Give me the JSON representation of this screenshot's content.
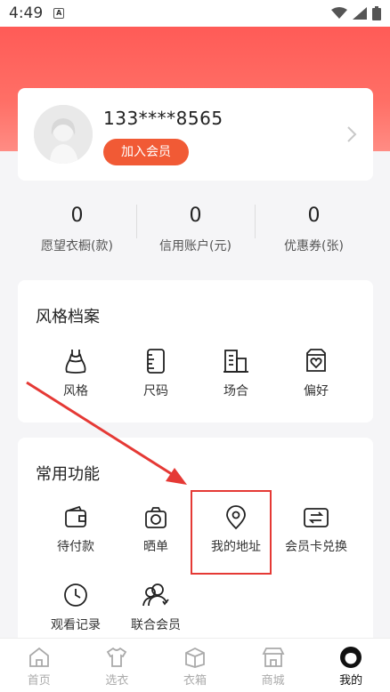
{
  "status_bar": {
    "time": "4:49"
  },
  "profile": {
    "phone": "133****8565",
    "join_button": "加入会员"
  },
  "stats": [
    {
      "value": "0",
      "label": "愿望衣橱(款)"
    },
    {
      "value": "0",
      "label": "信用账户(元)"
    },
    {
      "value": "0",
      "label": "优惠券(张)"
    }
  ],
  "style_section": {
    "title": "风格档案",
    "items": [
      {
        "label": "风格",
        "icon": "dress-icon"
      },
      {
        "label": "尺码",
        "icon": "size-icon"
      },
      {
        "label": "场合",
        "icon": "building-icon"
      },
      {
        "label": "偏好",
        "icon": "heart-box-icon"
      }
    ]
  },
  "functions_section": {
    "title": "常用功能",
    "items": [
      {
        "label": "待付款",
        "icon": "wallet-icon"
      },
      {
        "label": "晒单",
        "icon": "camera-icon"
      },
      {
        "label": "我的地址",
        "icon": "location-pin-icon"
      },
      {
        "label": "会员卡兑换",
        "icon": "card-exchange-icon"
      },
      {
        "label": "观看记录",
        "icon": "clock-icon"
      },
      {
        "label": "联合会员",
        "icon": "members-icon"
      }
    ]
  },
  "tabbar": {
    "items": [
      {
        "label": "首页",
        "icon": "home-icon",
        "active": false
      },
      {
        "label": "选衣",
        "icon": "shirt-icon",
        "active": false
      },
      {
        "label": "衣箱",
        "icon": "box-icon",
        "active": false
      },
      {
        "label": "商城",
        "icon": "shop-icon",
        "active": false
      },
      {
        "label": "我的",
        "icon": "profile-icon",
        "active": true
      }
    ]
  },
  "colors": {
    "accent": "#f15a35",
    "hero": "#ff5b57",
    "annotation": "#e53935"
  }
}
